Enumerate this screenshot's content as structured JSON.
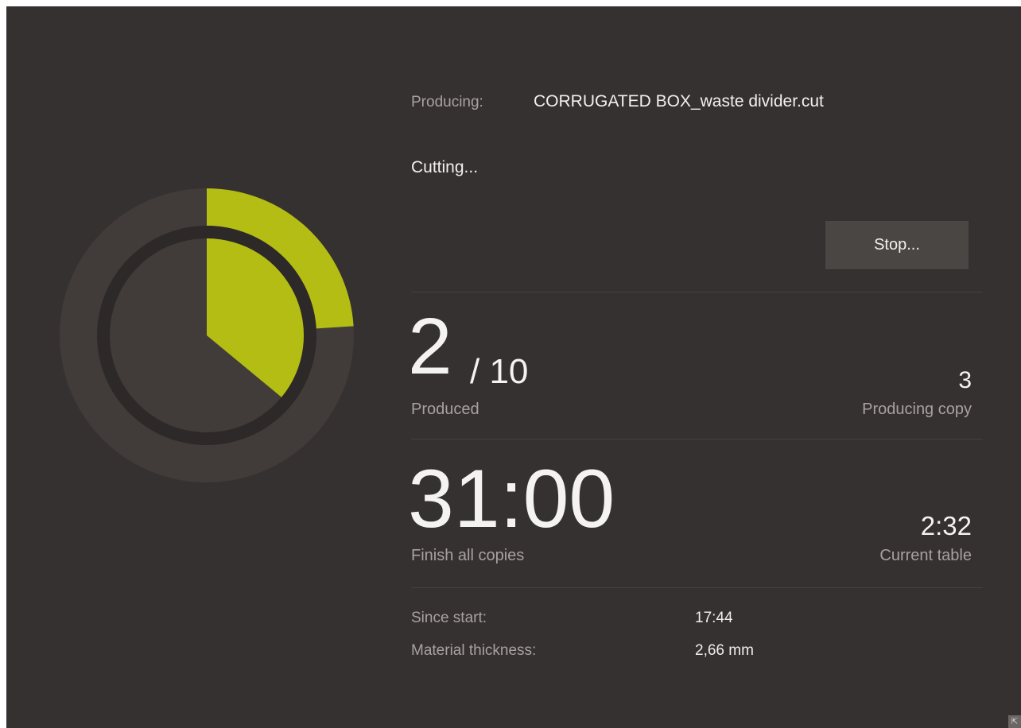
{
  "job": {
    "producing_label": "Producing:",
    "file_name": "CORRUGATED BOX_waste divider.cut",
    "status": "Cutting..."
  },
  "actions": {
    "stop_label": "Stop..."
  },
  "progress": {
    "produced": "2",
    "total": "/ 10",
    "produced_label": "Produced",
    "producing_copy": "3",
    "producing_copy_label": "Producing copy",
    "outer_fraction": 0.24,
    "inner_fraction": 0.36
  },
  "time": {
    "finish_all": "31:00",
    "finish_all_label": "Finish all copies",
    "current_table": "2:32",
    "current_table_label": "Current table"
  },
  "details": {
    "since_start_label": "Since start:",
    "since_start_value": "17:44",
    "thickness_label": "Material thickness:",
    "thickness_value": "2,66 mm"
  },
  "colors": {
    "background": "#353130",
    "ring_track": "#413c3a",
    "ring_gap": "#2d2928",
    "accent": "#b4bd13"
  },
  "icons": {
    "resize_grip": "resize-grip-icon"
  }
}
